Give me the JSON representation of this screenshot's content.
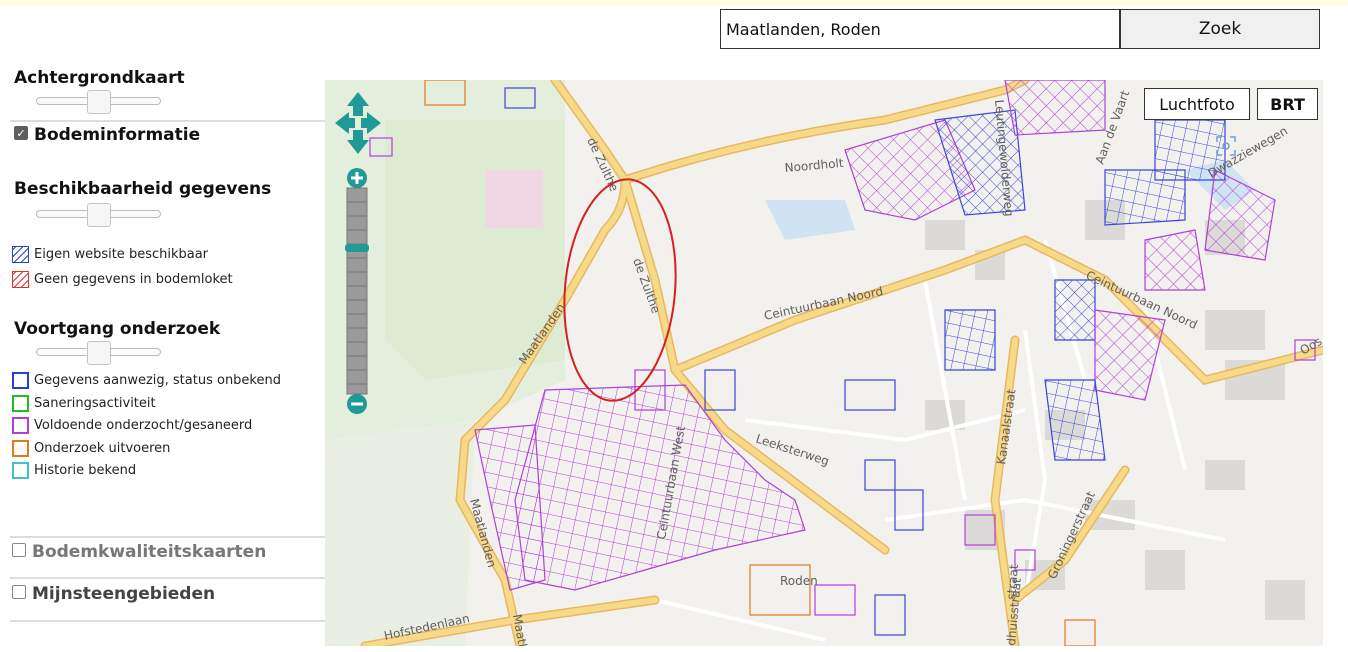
{
  "search": {
    "value": "Maatlanden, Roden",
    "button_label": "Zoek"
  },
  "sidebar": {
    "background_map_title": "Achtergrondkaart",
    "soil_info_label": "Bodeminformatie",
    "availability_title": "Beschikbaarheid gegevens",
    "availability_legend": [
      {
        "label": "Eigen website beschikbaar",
        "color": "#2a3fd6"
      },
      {
        "label": "Geen gegevens in bodemloket",
        "color": "#e03030"
      }
    ],
    "progress_title": "Voortgang onderzoek",
    "progress_legend": [
      {
        "label": "Gegevens aanwezig, status onbekend",
        "color": "#2a3fd6"
      },
      {
        "label": "Saneringsactiviteit",
        "color": "#22bb22"
      },
      {
        "label": "Voldoende onderzocht/gesaneerd",
        "color": "#b040d8"
      },
      {
        "label": "Onderzoek uitvoeren",
        "color": "#e07a20"
      },
      {
        "label": "Historie bekend",
        "color": "#40c0c8"
      }
    ],
    "quality_maps_label": "Bodemkwaliteitskaarten",
    "mine_areas_label": "Mijnsteengebieden"
  },
  "map": {
    "layer_buttons": {
      "aerial": "Luchtfoto",
      "brt": "BRT"
    },
    "street_labels": {
      "de_zulthe_north": "de Zulthe",
      "de_zulthe": "de Zulthe",
      "maatlanden_north": "Maatlanden",
      "maatlanden_south": "Maatlanden",
      "maatlanden_edge": "Maatl",
      "noordholt": "Noordholt",
      "leutingewolde": "Leutingewolderweg",
      "aan_de_vaart": "Aan de Vaart",
      "dwazziewegen": "Dwazziewegen",
      "centuurbaan_noord": "Ceintuurbaan Noord",
      "centuurbaan_noord_east": "Ceintuurbaan Noord",
      "centuurbaan_west": "Ceintuurbaan West",
      "leeksterweg": "Leeksterweg",
      "kanaalstraat": "Kanaalstraat",
      "groningerstraat": "Groningerstraat",
      "hofstedenlaan": "Hofstedenlaan",
      "roden": "Roden",
      "oos": "Oos",
      "straat": "straat",
      "dhuisstraat": "dhuisstraat"
    },
    "colors": {
      "road_major": "#f7d98a",
      "road_major_edge": "#e8b860",
      "purple": "#b040d8",
      "blue": "#3a48d8",
      "orange": "#e07a20",
      "highlight_ellipse": "#d42020",
      "nav_teal": "#1f9a96"
    }
  }
}
